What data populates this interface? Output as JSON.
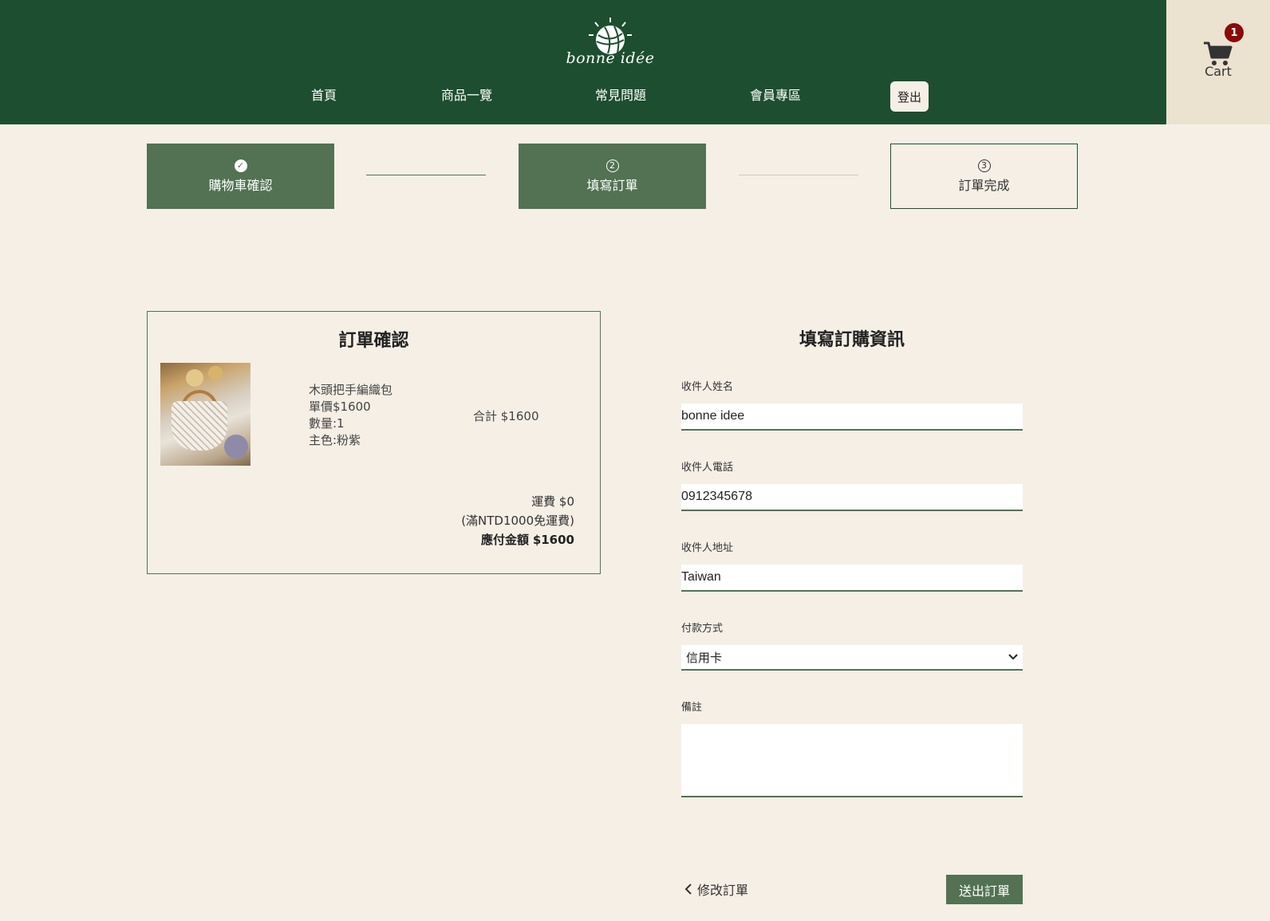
{
  "brand": {
    "logo_text": "bonne idée"
  },
  "nav": {
    "items": [
      {
        "label": "首頁"
      },
      {
        "label": "商品一覽"
      },
      {
        "label": "常見問題"
      },
      {
        "label": "會員專區"
      }
    ],
    "logout_label": "登出"
  },
  "cart": {
    "label": "Cart",
    "count": "1"
  },
  "steps": [
    {
      "icon": "✓",
      "label": "購物車確認"
    },
    {
      "icon": "2",
      "label": "填寫訂單"
    },
    {
      "icon": "3",
      "label": "訂單完成"
    }
  ],
  "summary": {
    "title": "訂單確認",
    "product": {
      "name": "木頭把手編織包",
      "price": "單價$1600",
      "quantity": "數量:1",
      "color": "主色:粉紫"
    },
    "subtotal": "合計 $1600",
    "shipping_fee": "運費 $0",
    "shipping_note": "(滿NTD1000免運費)",
    "total_label": "應付金額",
    "total_value": "$1600"
  },
  "form": {
    "title": "填寫訂購資訊",
    "name_label": "收件人姓名",
    "name_value": "bonne idee",
    "phone_label": "收件人電話",
    "phone_value": "0912345678",
    "address_label": "收件人地址",
    "address_value": "Taiwan",
    "payment_label": "付款方式",
    "payment_value": "信用卡",
    "note_label": "備註",
    "note_value": ""
  },
  "actions": {
    "back_label": "修改訂單",
    "submit_label": "送出訂單"
  },
  "colors": {
    "header_bg": "#1d4e2f",
    "accent": "#527253",
    "page_bg": "#f5efe6",
    "badge": "#8b0a0a"
  }
}
